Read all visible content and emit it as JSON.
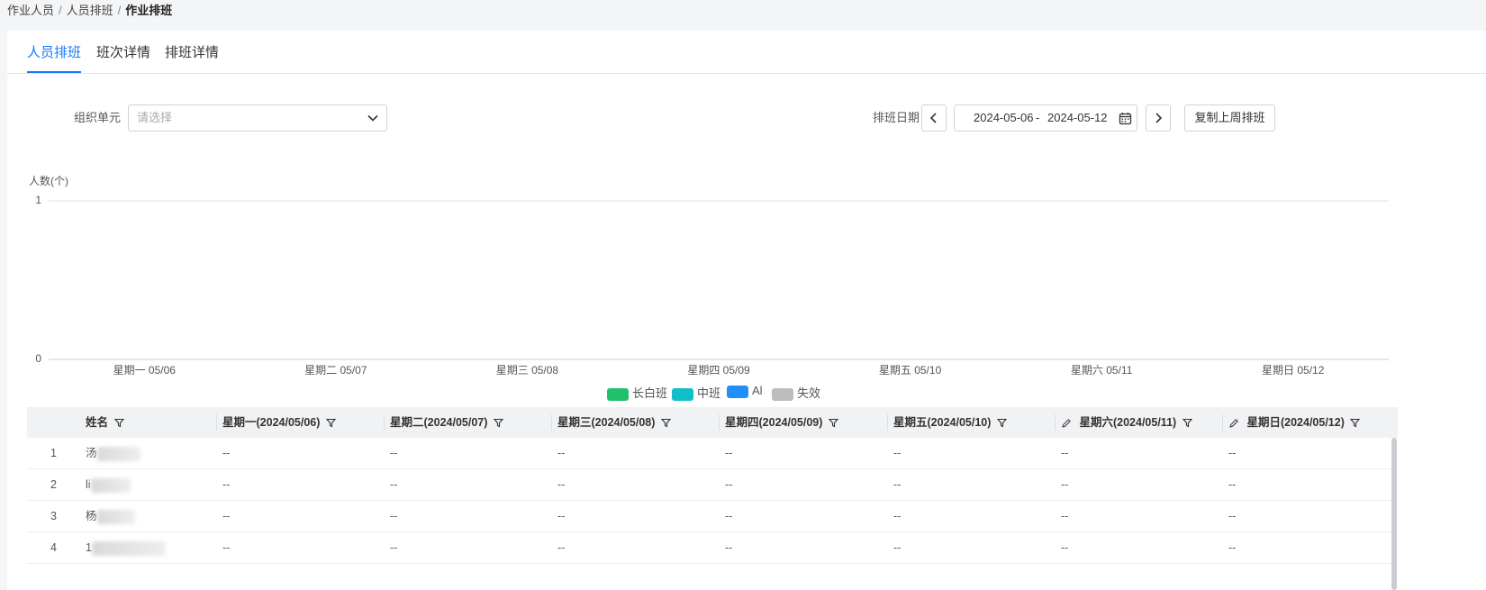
{
  "breadcrumb": [
    "作业人员",
    "人员排班",
    "作业排班"
  ],
  "tabs": [
    "人员排班",
    "班次详情",
    "排班详情"
  ],
  "filters": {
    "org_label": "组织单元",
    "org_placeholder": "请选择",
    "date_label": "排班日期",
    "date_start": "2024-05-06",
    "date_sep": "-",
    "date_end": "2024-05-12",
    "copy_button": "复制上周排班"
  },
  "chart_data": {
    "type": "bar",
    "ylabel": "人数(个)",
    "ylim": [
      0,
      1
    ],
    "yticks": [
      "1",
      "0"
    ],
    "categories": [
      "星期一 05/06",
      "星期二 05/07",
      "星期三 05/08",
      "星期四 05/09",
      "星期五 05/10",
      "星期六 05/11",
      "星期日 05/12"
    ],
    "series": [
      {
        "name": "长白班",
        "color": "#21c16b",
        "values": [
          0,
          0,
          0,
          0,
          0,
          0,
          0
        ]
      },
      {
        "name": "中班",
        "color": "#12bfc9",
        "values": [
          0,
          0,
          0,
          0,
          0,
          0,
          0
        ]
      },
      {
        "name": "Al",
        "color": "#2090f8",
        "values": [
          0,
          0,
          0,
          0,
          0,
          0,
          0
        ]
      },
      {
        "name": "失效",
        "color": "#bdbdbd",
        "values": [
          0,
          0,
          0,
          0,
          0,
          0,
          0
        ]
      }
    ],
    "legend": "bottom-center",
    "grid": true
  },
  "table": {
    "columns": [
      "姓名",
      "星期一(2024/05/06)",
      "星期二(2024/05/07)",
      "星期三(2024/05/08)",
      "星期四(2024/05/09)",
      "星期五(2024/05/10)",
      "星期六(2024/05/11)",
      "星期日(2024/05/12)"
    ],
    "rows": [
      {
        "index": "1",
        "name_hint": "汤",
        "cells": [
          "--",
          "--",
          "--",
          "--",
          "--",
          "--",
          "--"
        ]
      },
      {
        "index": "2",
        "name_hint": "li",
        "cells": [
          "--",
          "--",
          "--",
          "--",
          "--",
          "--",
          "--"
        ]
      },
      {
        "index": "3",
        "name_hint": "杨",
        "cells": [
          "--",
          "--",
          "--",
          "--",
          "--",
          "--",
          "--"
        ]
      },
      {
        "index": "4",
        "name_hint": "1",
        "cells": [
          "--",
          "--",
          "--",
          "--",
          "--",
          "--",
          "--"
        ]
      }
    ]
  }
}
